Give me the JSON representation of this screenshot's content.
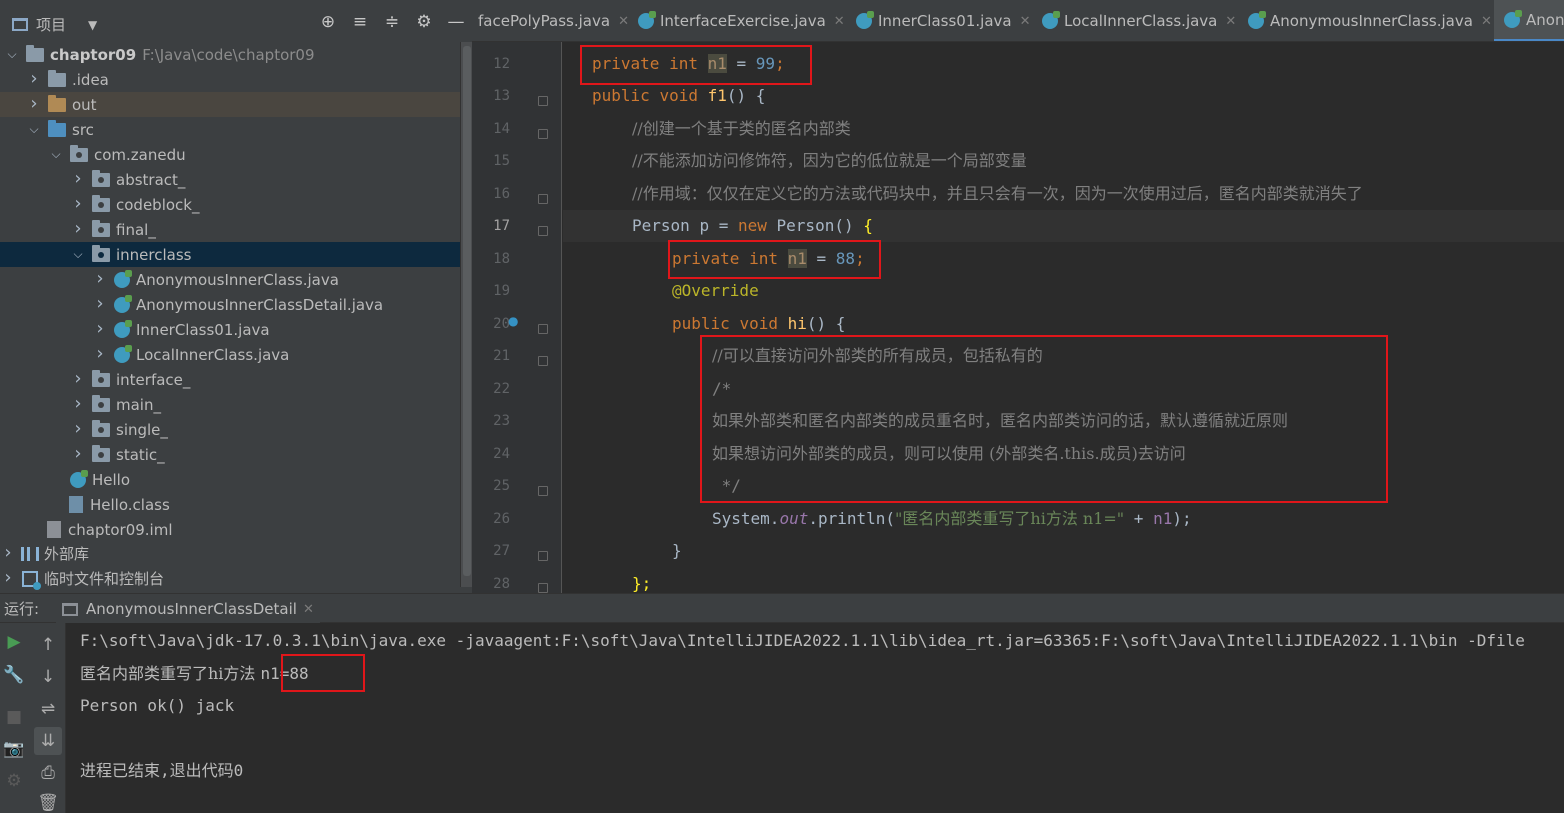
{
  "project_panel": {
    "title": "项目",
    "tools": [
      "⊕",
      "≡",
      "≑",
      "⚙",
      "—"
    ],
    "tree": [
      {
        "label": "chaptor09",
        "path": "F:\\Java\\code\\chaptor09"
      },
      {
        "label": ".idea"
      },
      {
        "label": "out"
      },
      {
        "label": "src"
      },
      {
        "label": "com.zanedu"
      },
      {
        "label": "abstract_"
      },
      {
        "label": "codeblock_"
      },
      {
        "label": "final_"
      },
      {
        "label": "innerclass"
      },
      {
        "label": "AnonymousInnerClass.java"
      },
      {
        "label": "AnonymousInnerClassDetail.java"
      },
      {
        "label": "InnerClass01.java"
      },
      {
        "label": "LocalInnerClass.java"
      },
      {
        "label": "interface_"
      },
      {
        "label": "main_"
      },
      {
        "label": "single_"
      },
      {
        "label": "static_"
      },
      {
        "label": "Hello"
      },
      {
        "label": "Hello.class"
      },
      {
        "label": "chaptor09.iml"
      },
      {
        "label": "外部库"
      },
      {
        "label": "临时文件和控制台"
      }
    ]
  },
  "editor": {
    "tabs": [
      {
        "label": "facePolyPass.java"
      },
      {
        "label": "InterfaceExercise.java"
      },
      {
        "label": "InnerClass01.java"
      },
      {
        "label": "LocalInnerClass.java"
      },
      {
        "label": "AnonymousInnerClass.java"
      },
      {
        "label": "Anon"
      }
    ],
    "line_numbers": [
      "12",
      "13",
      "14",
      "15",
      "16",
      "17",
      "18",
      "19",
      "20",
      "21",
      "22",
      "23",
      "24",
      "25",
      "26",
      "27",
      "28"
    ],
    "current_line": "17",
    "code": {
      "l12": {
        "kw1": "private",
        "kw2": "int",
        "var": "n1",
        "op": " = ",
        "num": "99",
        "semi": ";"
      },
      "l13": {
        "kw1": "public",
        "kw2": "void",
        "fn": "f1",
        "rest": "() {"
      },
      "l14": "//创建一个基于类的匿名内部类",
      "l15": "//不能添加访问修饰符，因为它的低位就是一个局部变量",
      "l16": "//作用域：仅仅在定义它的方法或代码块中，并且只会有一次，因为一次使用过后，匿名内部类就消失了",
      "l17": {
        "type": "Person",
        "var": "p",
        "op": " = ",
        "kw": "new",
        "ctor": "Person",
        "rest": "() ",
        "brace": "{"
      },
      "l18": {
        "kw1": "private",
        "kw2": "int",
        "var": "n1",
        "op": " = ",
        "num": "88",
        "semi": ";"
      },
      "l19": "@Override",
      "l20": {
        "kw1": "public",
        "kw2": "void",
        "fn": "hi",
        "rest": "() {"
      },
      "l21": "//可以直接访问外部类的所有成员，包括私有的",
      "l22": "/*",
      "l23": "如果外部类和匿名内部类的成员重名时，匿名内部类访问的话，默认遵循就近原则",
      "l24": "如果想访问外部类的成员，则可以使用 (外部类名.this.成员)去访问",
      "l25": " */",
      "l26": {
        "cls": "System",
        "dot1": ".",
        "fld": "out",
        "dot2": ".",
        "m": "println(",
        "str": "\"匿名内部类重写了hi方法 n1=\"",
        "op": " + ",
        "var": "n1",
        "end": ");"
      },
      "l27": "}",
      "l28": "};"
    }
  },
  "run_panel": {
    "label": "运行:",
    "tab": "AnonymousInnerClassDetail",
    "output": {
      "cmd": "F:\\soft\\Java\\jdk-17.0.3.1\\bin\\java.exe -javaagent:F:\\soft\\Java\\IntelliJIDEA2022.1.1\\lib\\idea_rt.jar=63365:F:\\soft\\Java\\IntelliJIDEA2022.1.1\\bin -Dfile",
      "line2_prefix": "匿名内部类重写了hi方法 ",
      "line2_value": "n1=88",
      "line3": "Person ok() jack",
      "line5": "进程已结束,退出代码0"
    },
    "tools": [
      "▶",
      "↑",
      "↓",
      "⇌",
      "⇊",
      "⎙",
      "🗑",
      "🔧",
      "■",
      "📷",
      "⚙"
    ]
  },
  "colors": {
    "highlight_box": "#e0161a",
    "keyword": "#cc7832",
    "number": "#6897bb",
    "comment": "#808080",
    "function": "#ffc66d"
  }
}
